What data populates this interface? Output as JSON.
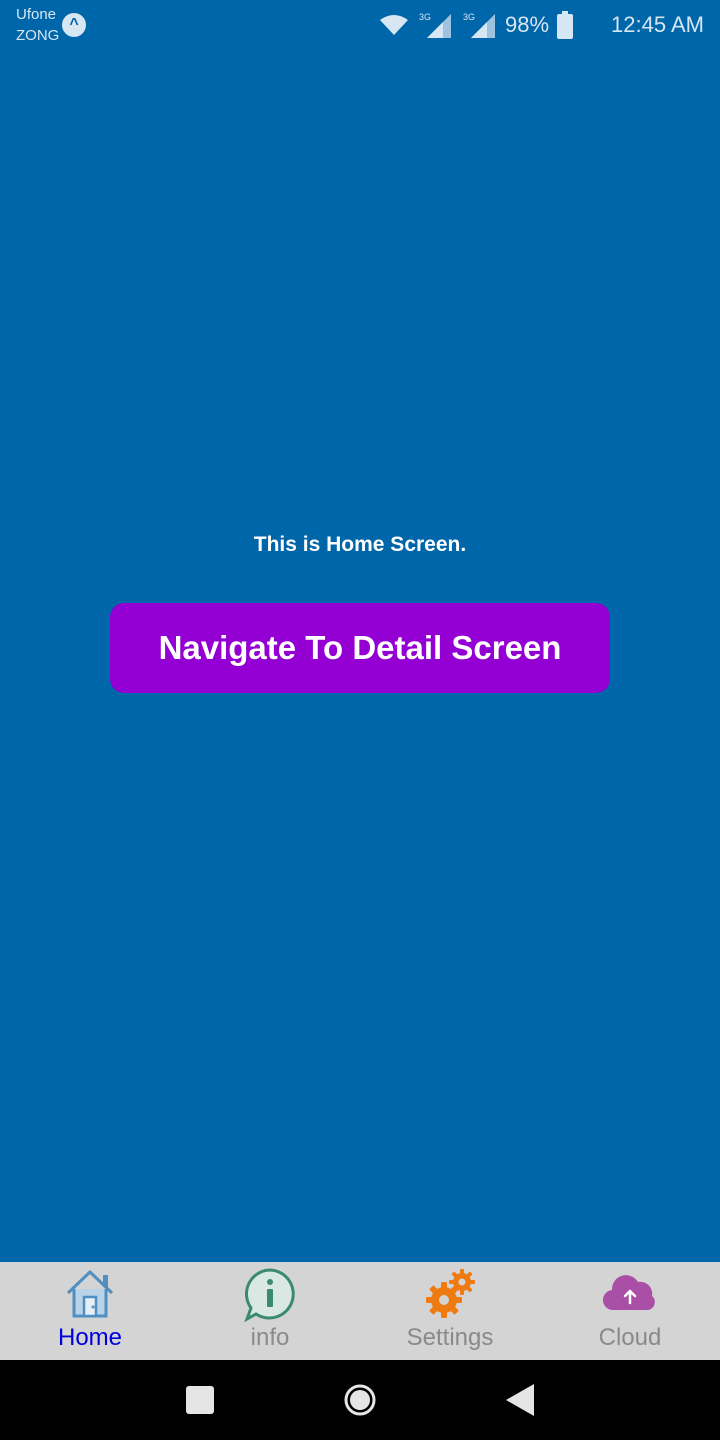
{
  "status_bar": {
    "carrier_1": "Ufone",
    "carrier_2": "ZONG",
    "network_1": "3G",
    "network_2": "3G",
    "battery": "98%",
    "time": "12:45 AM"
  },
  "main": {
    "message": "This is Home Screen.",
    "button_label": "Navigate To Detail Screen",
    "background_color": "#0066aa",
    "button_color": "#9400d3"
  },
  "tabs": [
    {
      "label": "Home",
      "icon": "home-icon",
      "active": true
    },
    {
      "label": "info",
      "icon": "info-icon",
      "active": false
    },
    {
      "label": "Settings",
      "icon": "gears-icon",
      "active": false
    },
    {
      "label": "Cloud",
      "icon": "cloud-upload-icon",
      "active": false
    }
  ],
  "colors": {
    "tab_bar": "#d4d4d4",
    "active_tab_label": "#0000dd",
    "inactive_tab_label": "#8a8a8a"
  }
}
